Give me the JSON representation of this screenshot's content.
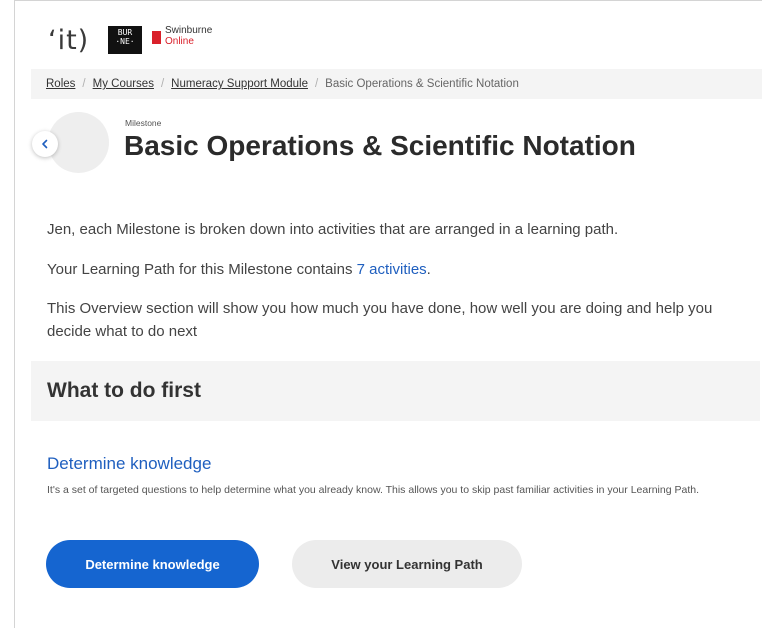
{
  "header": {
    "logo_it": "ʻit)",
    "logo_burne": "BUR\n·NE·",
    "logo_swinburne": "Swinburne",
    "logo_online": "Online"
  },
  "breadcrumb": {
    "items": [
      {
        "label": "Roles"
      },
      {
        "label": "My Courses"
      },
      {
        "label": "Numeracy Support Module"
      }
    ],
    "separator": "/",
    "current": "Basic Operations & Scientific Notation"
  },
  "title_area": {
    "eyebrow": "Milestone",
    "title": "Basic Operations & Scientific Notation"
  },
  "intro": {
    "line1": "Jen, each Milestone is broken down into activities that are arranged in a learning path.",
    "line2_prefix": "Your Learning Path for this Milestone contains ",
    "line2_link": "7 activities",
    "line2_suffix": ".",
    "line3": "This Overview section will show you how much you have done, how well you are doing and help you decide what to do next"
  },
  "section": {
    "title": "What to do first"
  },
  "determine": {
    "link": "Determine knowledge",
    "description": "It's a set of targeted questions to help determine what you already know. This allows you to skip past familiar activities in your Learning Path.",
    "primary_button": "Determine knowledge",
    "secondary_button": "View your Learning Path"
  },
  "colors": {
    "accent": "#1565d0",
    "link": "#1f5fbf",
    "brand_red": "#d9202a",
    "band_bg": "#f4f4f4"
  },
  "icons": {
    "back": "chevron-left-icon"
  }
}
